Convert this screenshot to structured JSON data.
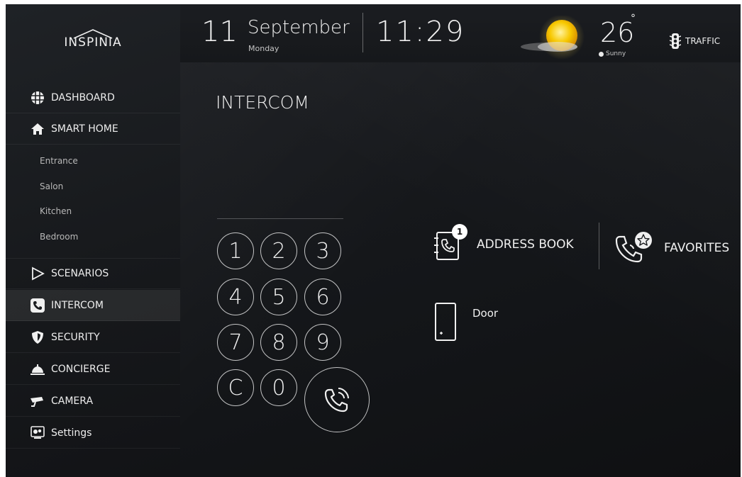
{
  "brand": {
    "logo_text": "INSPINIA"
  },
  "header": {
    "day": "11",
    "month": "September",
    "weekday": "Monday",
    "time": "11:29",
    "temperature": "26",
    "degree_symbol": "°",
    "condition": "Sunny",
    "traffic_label": "TRAFFIC"
  },
  "sidebar": {
    "items": [
      {
        "label": "DASHBOARD",
        "icon": "dashboard-grid-icon"
      },
      {
        "label": "SMART HOME",
        "icon": "home-icon"
      },
      {
        "label": "SCENARIOS",
        "icon": "play-triangle-icon"
      },
      {
        "label": "INTERCOM",
        "icon": "phone-icon",
        "active": true
      },
      {
        "label": "SECURITY",
        "icon": "shield-icon"
      },
      {
        "label": "CONCIERGE",
        "icon": "service-bell-icon"
      },
      {
        "label": "CAMERA",
        "icon": "cctv-camera-icon"
      },
      {
        "label": "Settings",
        "icon": "settings-gears-icon"
      }
    ],
    "sub_items": [
      "Entrance",
      "Salon",
      "Kitchen",
      "Bedroom"
    ]
  },
  "main": {
    "title": "INTERCOM",
    "keypad": [
      "1",
      "2",
      "3",
      "4",
      "5",
      "6",
      "7",
      "8",
      "9",
      "C",
      "0"
    ],
    "address_book_label": "ADDRESS BOOK",
    "address_book_badge": "1",
    "favorites_label": "FAVORITES",
    "door_label": "Door"
  },
  "colors": {
    "background": "#131518",
    "text": "#f0f0f0",
    "sun": "#f5c400"
  }
}
